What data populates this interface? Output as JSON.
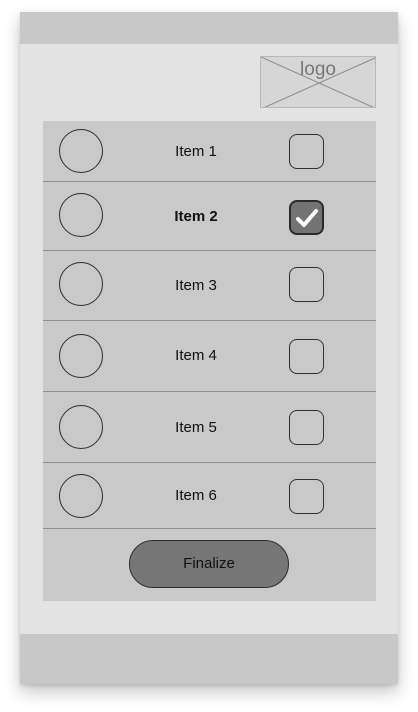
{
  "logo": {
    "text": "logo"
  },
  "list": {
    "items": [
      {
        "label": "Item 1",
        "checked": false,
        "bold": false
      },
      {
        "label": "Item 2",
        "checked": true,
        "bold": true
      },
      {
        "label": "Item 3",
        "checked": false,
        "bold": false
      },
      {
        "label": "Item 4",
        "checked": false,
        "bold": false
      },
      {
        "label": "Item 5",
        "checked": false,
        "bold": false
      },
      {
        "label": "Item 6",
        "checked": false,
        "bold": false
      }
    ]
  },
  "actions": {
    "finalize_label": "Finalize"
  },
  "colors": {
    "bars": "#c8c8c8",
    "screen": "#e3e3e3",
    "panel": "#c9c9c9",
    "checked_fill": "#737373",
    "button_fill": "#767676"
  },
  "icons": {
    "placeholder": "image-placeholder-icon",
    "avatar": "circle-avatar-icon",
    "check": "checkmark-icon"
  }
}
